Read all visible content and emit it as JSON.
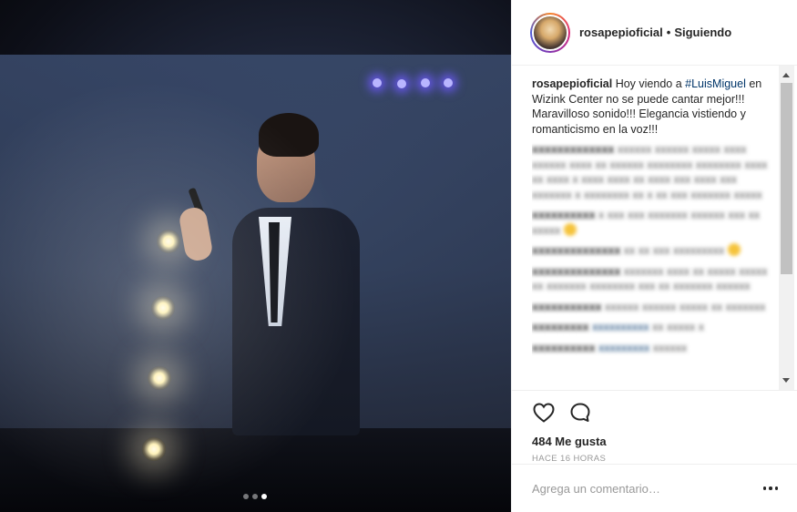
{
  "post": {
    "username": "rosapepioficial",
    "separator": "•",
    "follow_status": "Siguiendo",
    "caption": {
      "username": "rosapepioficial",
      "text_before": " Hoy viendo a ",
      "hashtag": "#LuisMiguel",
      "text_after": " en Wizink Center no se puede cantar mejor!!! Maravilloso sonido!!! Elegancia vistiendo y romanticismo en la voz!!!"
    },
    "likes": "484 Me gusta",
    "time": "HACE 16 HORAS",
    "comment_placeholder": "Agrega un comentario…"
  },
  "carousel": {
    "count": 3,
    "active_index": 2
  },
  "icons": {
    "like": "heart-icon",
    "comment": "comment-bubble-icon",
    "more": "more-options-icon"
  }
}
